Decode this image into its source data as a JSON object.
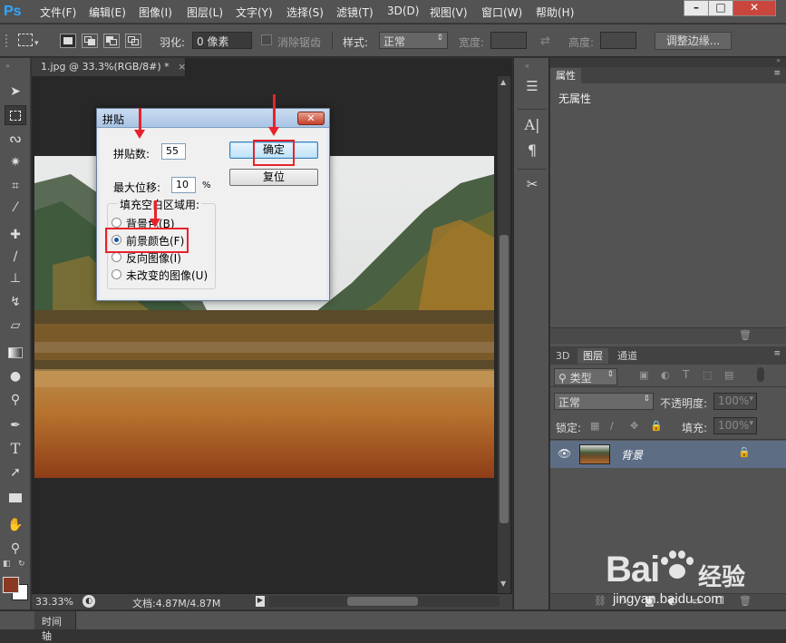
{
  "app": {
    "logo": "Ps"
  },
  "menubar": {
    "items": [
      "文件(F)",
      "编辑(E)",
      "图像(I)",
      "图层(L)",
      "文字(Y)",
      "选择(S)",
      "滤镜(T)",
      "3D(D)",
      "视图(V)",
      "窗口(W)",
      "帮助(H)"
    ]
  },
  "window_controls": {
    "minimize": "–",
    "maximize": "□",
    "close": "✕"
  },
  "options": {
    "feather_label": "羽化:",
    "feather_value": "0 像素",
    "antialias_label": "消除锯齿",
    "style_label": "样式:",
    "style_value": "正常",
    "width_label": "宽度:",
    "height_label": "高度:",
    "refine_button": "调整边缘..."
  },
  "document": {
    "tab_title": "1.jpg @ 33.3%(RGB/8#) *",
    "zoom": "33.33%",
    "doc_info": "文档:4.87M/4.87M"
  },
  "timeline": {
    "label": "时间轴"
  },
  "properties_panel": {
    "tab": "属性",
    "content": "无属性"
  },
  "layers_panel": {
    "tabs": [
      "3D",
      "图层",
      "通道"
    ],
    "kind_label": "类型",
    "blend_mode": "正常",
    "opacity_label": "不透明度:",
    "opacity_value": "100%",
    "lock_label": "锁定:",
    "fill_label": "填充:",
    "fill_value": "100%",
    "layer_name": "背景"
  },
  "dialog": {
    "title": "拼贴",
    "tiles_label": "拼贴数:",
    "tiles_value": "55",
    "offset_label": "最大位移:",
    "offset_value": "10",
    "offset_unit": "%",
    "group_label": "填充空白区域用:",
    "options": [
      "背景色(B)",
      "前景颜色(F)",
      "反向图像(I)",
      "未改变的图像(U)"
    ],
    "selected_option": "前景颜色(F)",
    "ok_button": "确定",
    "reset_button": "复位"
  },
  "colors": {
    "foreground": "#8a3a22",
    "background": "#ffffff",
    "annotation_red": "#e8222a",
    "ps_blue": "#31a8ff"
  },
  "watermark": {
    "brand": "Bai",
    "cn": "经验",
    "url": "jingyan.baidu.com"
  }
}
